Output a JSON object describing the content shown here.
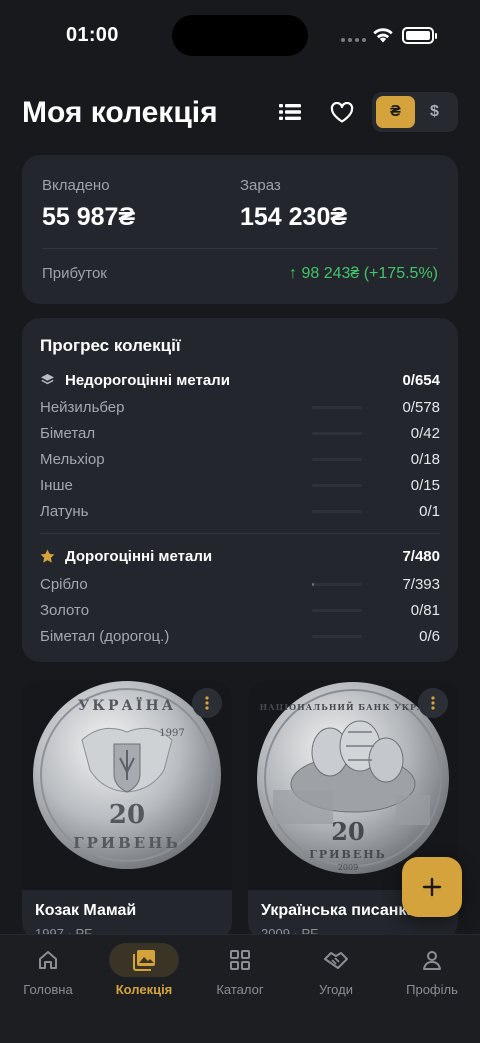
{
  "status": {
    "time": "01:00"
  },
  "header": {
    "title": "Моя колекція",
    "currency_uah": "₴",
    "currency_usd": "$",
    "list_icon": "list-icon",
    "fav_icon": "heart-icon"
  },
  "summary": {
    "invested_label": "Вкладено",
    "invested_value": "55 987₴",
    "now_label": "Зараз",
    "now_value": "154 230₴",
    "profit_label": "Прибуток",
    "profit_value": "↑ 98 243₴ (+175.5%)",
    "profit_color": "#45c36a"
  },
  "progress": {
    "title": "Прогрес колекції",
    "groups": [
      {
        "name": "Недорогоцінні метали",
        "value": "0/654",
        "icon": "layers-icon",
        "items": [
          {
            "name": "Нейзильбер",
            "value": "0/578",
            "fraction": 0
          },
          {
            "name": "Біметал",
            "value": "0/42",
            "fraction": 0
          },
          {
            "name": "Мельхіор",
            "value": "0/18",
            "fraction": 0
          },
          {
            "name": "Інше",
            "value": "0/15",
            "fraction": 0
          },
          {
            "name": "Латунь",
            "value": "0/1",
            "fraction": 0
          }
        ]
      },
      {
        "name": "Дорогоцінні метали",
        "value": "7/480",
        "icon": "star-icon",
        "items": [
          {
            "name": "Срібло",
            "value": "7/393",
            "fraction": 0.018
          },
          {
            "name": "Золото",
            "value": "0/81",
            "fraction": 0
          },
          {
            "name": "Біметал (дорогоц.)",
            "value": "0/6",
            "fraction": 0
          }
        ]
      }
    ]
  },
  "coins": [
    {
      "name": "Козак Мамай",
      "sub": "1997 · PF",
      "top": "УКРАЇНА",
      "denom": "20",
      "word": "ГРИВЕНЬ",
      "year": "1997"
    },
    {
      "name": "Українська писанка",
      "sub": "2009 · PF",
      "top": "НАЦІОНАЛЬНИЙ БАНК УКРАЇНИ",
      "denom": "20",
      "word": "ГРИВЕНЬ",
      "year": "2009"
    }
  ],
  "nav": [
    {
      "label": "Головна",
      "icon": "home-icon"
    },
    {
      "label": "Колекція",
      "icon": "collection-icon",
      "active": true
    },
    {
      "label": "Каталог",
      "icon": "grid-icon"
    },
    {
      "label": "Угоди",
      "icon": "handshake-icon"
    },
    {
      "label": "Профіль",
      "icon": "profile-icon"
    }
  ],
  "accent": "#d4a33b"
}
